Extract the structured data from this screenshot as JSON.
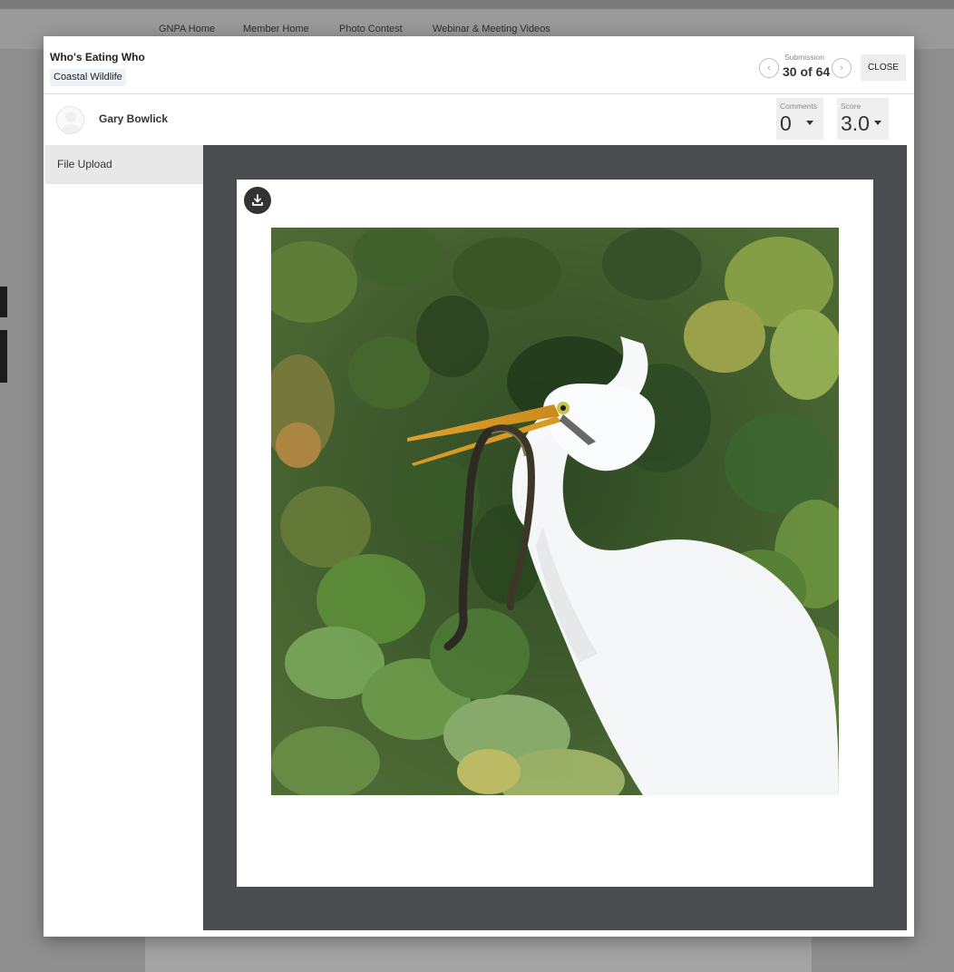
{
  "background_nav": {
    "items": [
      "GNPA Home",
      "Member Home",
      "Photo Contest",
      "Webinar & Meeting Videos"
    ]
  },
  "modal": {
    "title": "Who's Eating Who",
    "category": "Coastal Wildlife",
    "submission": {
      "label": "Submission",
      "counter": "30 of 64",
      "prev_icon": "chevron-left-icon",
      "next_icon": "chevron-right-icon"
    },
    "close_label": "CLOSE",
    "author": {
      "name": "Gary Bowlick",
      "avatar_icon": "default-avatar-icon"
    },
    "comments": {
      "label": "Comments",
      "value": "0"
    },
    "score": {
      "label": "Score",
      "value": "3.0"
    },
    "sidebar": {
      "items": [
        {
          "label": "File Upload",
          "selected": true
        }
      ]
    },
    "viewer": {
      "download_icon": "download-icon",
      "image_subject": "white egret holding a snake in its beak against green foliage"
    }
  },
  "colors": {
    "viewer_background": "#4a4c50",
    "selected_item": "#e8e8e8",
    "chip_background": "#eef2f7"
  }
}
